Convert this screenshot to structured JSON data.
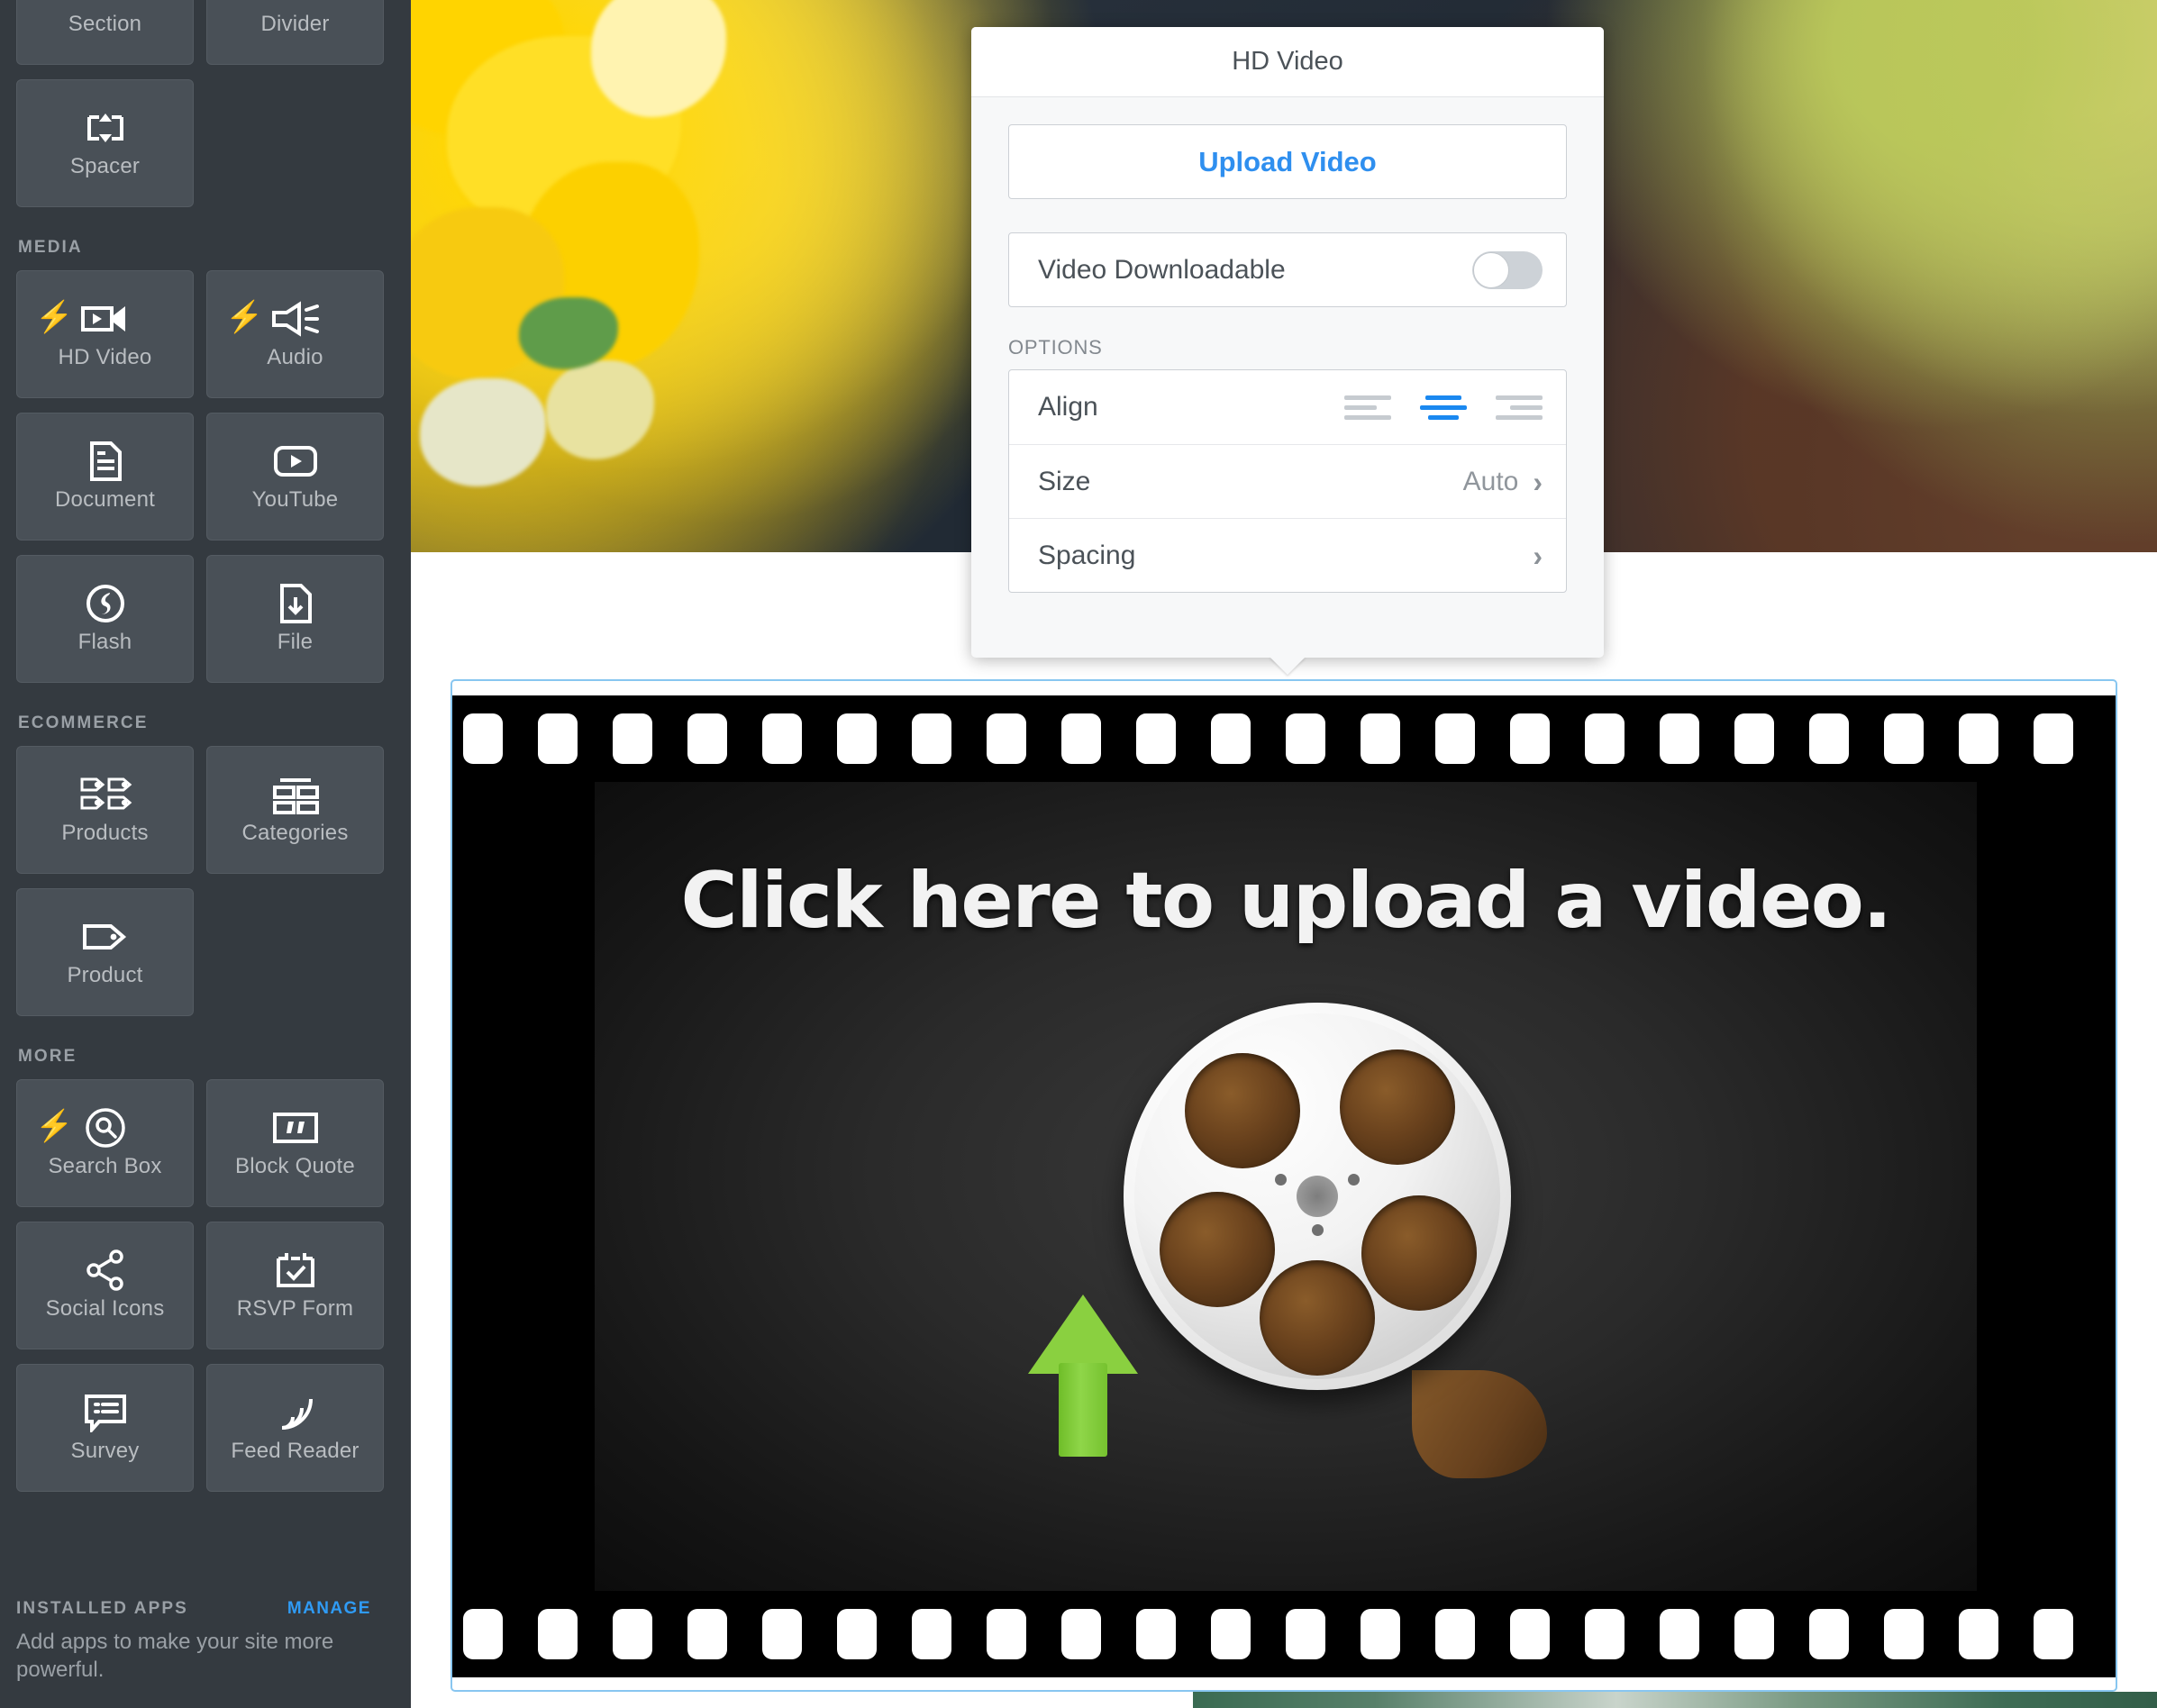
{
  "sidebar": {
    "top_tiles": [
      {
        "label": "Section",
        "icon": "section-icon",
        "pro": false
      },
      {
        "label": "Divider",
        "icon": "divider-icon",
        "pro": false
      },
      {
        "label": "Spacer",
        "icon": "spacer-icon",
        "pro": false
      }
    ],
    "sections": [
      {
        "title": "MEDIA",
        "tiles": [
          {
            "label": "HD Video",
            "icon": "video-camera-icon",
            "pro": true
          },
          {
            "label": "Audio",
            "icon": "speaker-icon",
            "pro": true
          },
          {
            "label": "Document",
            "icon": "document-icon",
            "pro": false
          },
          {
            "label": "YouTube",
            "icon": "youtube-icon",
            "pro": false
          },
          {
            "label": "Flash",
            "icon": "flash-icon",
            "pro": false
          },
          {
            "label": "File",
            "icon": "file-download-icon",
            "pro": false
          }
        ]
      },
      {
        "title": "ECOMMERCE",
        "tiles": [
          {
            "label": "Products",
            "icon": "products-tags-icon",
            "pro": false
          },
          {
            "label": "Categories",
            "icon": "categories-icon",
            "pro": false
          },
          {
            "label": "Product",
            "icon": "product-tag-icon",
            "pro": false
          }
        ]
      },
      {
        "title": "MORE",
        "tiles": [
          {
            "label": "Search Box",
            "icon": "search-circle-icon",
            "pro": true
          },
          {
            "label": "Block Quote",
            "icon": "quote-icon",
            "pro": false
          },
          {
            "label": "Social Icons",
            "icon": "share-icon",
            "pro": false
          },
          {
            "label": "RSVP Form",
            "icon": "calendar-check-icon",
            "pro": false
          },
          {
            "label": "Survey",
            "icon": "survey-icon",
            "pro": false
          },
          {
            "label": "Feed Reader",
            "icon": "rss-icon",
            "pro": false
          }
        ]
      }
    ],
    "installed_apps": {
      "title": "INSTALLED APPS",
      "manage_label": "MANAGE",
      "description": "Add apps to make your site more powerful."
    }
  },
  "popup": {
    "title": "HD Video",
    "upload_button": "Upload Video",
    "downloadable": {
      "label": "Video Downloadable",
      "enabled": false
    },
    "options_label": "OPTIONS",
    "options": {
      "align": {
        "label": "Align",
        "value": "center",
        "choices": [
          "left",
          "center",
          "right"
        ]
      },
      "size": {
        "label": "Size",
        "value": "Auto",
        "chevron": "›"
      },
      "spacing": {
        "label": "Spacing",
        "value": "",
        "chevron": "›"
      }
    }
  },
  "canvas": {
    "video_placeholder": {
      "text": "Click here to upload a video."
    }
  },
  "colors": {
    "accent_blue": "#2f8fef",
    "selection_blue": "#88c6f0",
    "sidebar_bg": "#343a40",
    "tile_bg": "#495057",
    "pro_bolt": "#f7a928"
  }
}
